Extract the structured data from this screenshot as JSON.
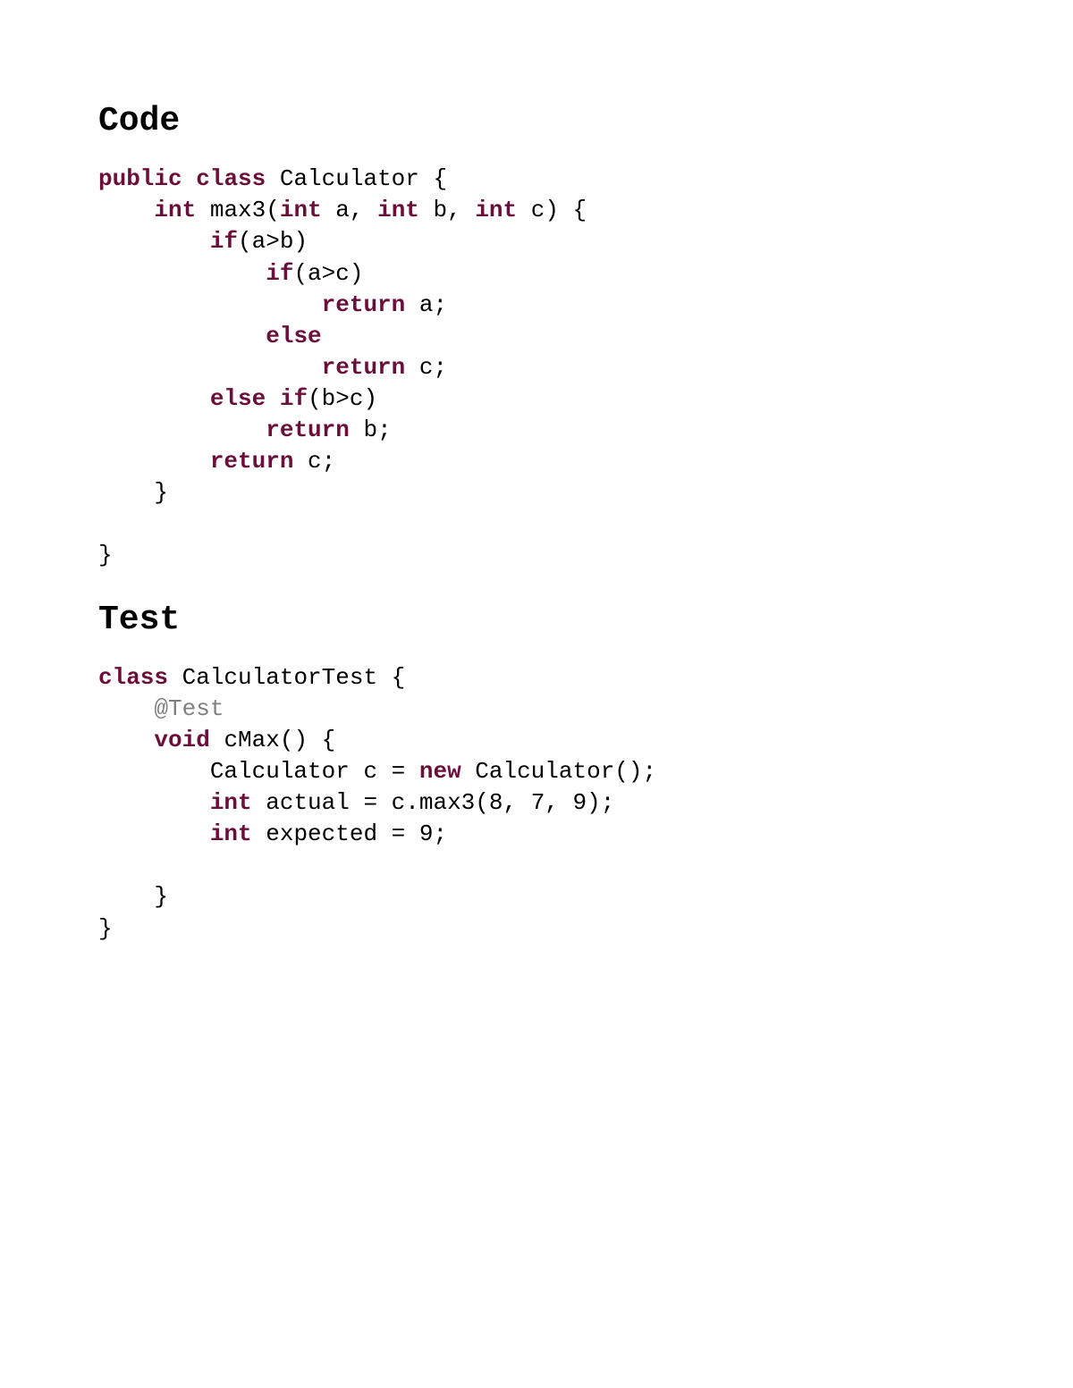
{
  "headings": {
    "code": "Code",
    "test": "Test"
  },
  "code_block": {
    "lines": [
      [
        {
          "t": "public",
          "c": "kw"
        },
        {
          "t": " ",
          "c": "plain"
        },
        {
          "t": "class",
          "c": "kw"
        },
        {
          "t": " Calculator {",
          "c": "plain"
        }
      ],
      [
        {
          "t": "    ",
          "c": "plain"
        },
        {
          "t": "int",
          "c": "kw"
        },
        {
          "t": " max3(",
          "c": "plain"
        },
        {
          "t": "int",
          "c": "kw"
        },
        {
          "t": " a, ",
          "c": "plain"
        },
        {
          "t": "int",
          "c": "kw"
        },
        {
          "t": " b, ",
          "c": "plain"
        },
        {
          "t": "int",
          "c": "kw"
        },
        {
          "t": " c) {",
          "c": "plain"
        }
      ],
      [
        {
          "t": "        ",
          "c": "plain"
        },
        {
          "t": "if",
          "c": "kw"
        },
        {
          "t": "(a>b)",
          "c": "plain"
        }
      ],
      [
        {
          "t": "            ",
          "c": "plain"
        },
        {
          "t": "if",
          "c": "kw"
        },
        {
          "t": "(a>c)",
          "c": "plain"
        }
      ],
      [
        {
          "t": "                ",
          "c": "plain"
        },
        {
          "t": "return",
          "c": "kw"
        },
        {
          "t": " a;",
          "c": "plain"
        }
      ],
      [
        {
          "t": "            ",
          "c": "plain"
        },
        {
          "t": "else",
          "c": "kw"
        }
      ],
      [
        {
          "t": "                ",
          "c": "plain"
        },
        {
          "t": "return",
          "c": "kw"
        },
        {
          "t": " c;",
          "c": "plain"
        }
      ],
      [
        {
          "t": "        ",
          "c": "plain"
        },
        {
          "t": "else",
          "c": "kw"
        },
        {
          "t": " ",
          "c": "plain"
        },
        {
          "t": "if",
          "c": "kw"
        },
        {
          "t": "(b>c)",
          "c": "plain"
        }
      ],
      [
        {
          "t": "            ",
          "c": "plain"
        },
        {
          "t": "return",
          "c": "kw"
        },
        {
          "t": " b;",
          "c": "plain"
        }
      ],
      [
        {
          "t": "        ",
          "c": "plain"
        },
        {
          "t": "return",
          "c": "kw"
        },
        {
          "t": " c;",
          "c": "plain"
        }
      ],
      [
        {
          "t": "    }",
          "c": "plain"
        }
      ],
      [
        {
          "t": " ",
          "c": "plain"
        }
      ],
      [
        {
          "t": "}",
          "c": "plain"
        }
      ]
    ]
  },
  "test_block": {
    "lines": [
      [
        {
          "t": "class",
          "c": "kw"
        },
        {
          "t": " CalculatorTest {",
          "c": "plain"
        }
      ],
      [
        {
          "t": "    ",
          "c": "plain"
        },
        {
          "t": "@Test",
          "c": "ann"
        }
      ],
      [
        {
          "t": "    ",
          "c": "plain"
        },
        {
          "t": "void",
          "c": "kw"
        },
        {
          "t": " cMax() {",
          "c": "plain"
        }
      ],
      [
        {
          "t": "        Calculator c = ",
          "c": "plain"
        },
        {
          "t": "new",
          "c": "kw"
        },
        {
          "t": " Calculator();",
          "c": "plain"
        }
      ],
      [
        {
          "t": "        ",
          "c": "plain"
        },
        {
          "t": "int",
          "c": "kw"
        },
        {
          "t": " actual = c.max3(8, 7, 9);",
          "c": "plain"
        }
      ],
      [
        {
          "t": "        ",
          "c": "plain"
        },
        {
          "t": "int",
          "c": "kw"
        },
        {
          "t": " expected = 9;",
          "c": "plain"
        }
      ],
      [
        {
          "t": " ",
          "c": "plain"
        }
      ],
      [
        {
          "t": "    }",
          "c": "plain"
        }
      ],
      [
        {
          "t": "}",
          "c": "plain"
        }
      ]
    ]
  }
}
